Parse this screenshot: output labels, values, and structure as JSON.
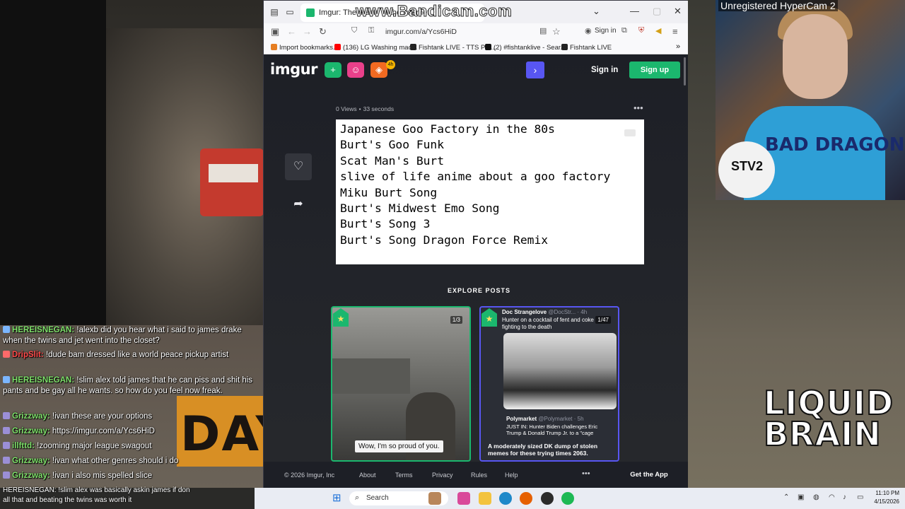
{
  "overlay": {
    "bandicam": "www.Bandicam.com",
    "hypercam": "Unregistered HyperCam 2",
    "liquid_brain": [
      "LIQUID",
      "BRAIN"
    ],
    "day_text": "DAY",
    "webcam_shirt": "BAD DRAGON",
    "webcam_badge": "STV2"
  },
  "chat": [
    {
      "user": "HEREISNEGAN:",
      "text": "!alexb did you hear what i said to james drake when the twins and jet went into the closet?",
      "color": "#7ee06a"
    },
    {
      "user": "DripSlit:",
      "text": "!dude bam dressed like a world peace pickup artist",
      "color": "#ff4a4a"
    },
    {
      "user": "HEREISNEGAN:",
      "text": "!slim alex told james that he can piss and shit his pants and be gay all he wants. so how do you feel now freak.",
      "color": "#7ee06a"
    },
    {
      "user": "Grizzway:",
      "text": "!ivan these are your options",
      "color": "#7ee06a"
    },
    {
      "user": "Grizzway:",
      "text": "https://imgur.com/a/Ycs6HiD",
      "color": "#7ee06a"
    },
    {
      "user": "illfttd:",
      "text": "!zooming major league swagout",
      "color": "#7ee06a"
    },
    {
      "user": "Grizzway:",
      "text": "!ivan what other genres should i do",
      "color": "#7ee06a"
    },
    {
      "user": "Grizzway:",
      "text": "!ivan i also mis spelled slice",
      "color": "#7ee06a"
    }
  ],
  "chat_footer": [
    "HEREISNEGAN: !slim alex was basically askin james if don",
    "all that and beating the twins was worth it"
  ],
  "browser": {
    "tab_title": "Imgur: The magic of the Internet",
    "url": "imgur.com/a/Ycs6HiD",
    "nav_signin": "Sign in",
    "bookmarks": [
      {
        "label": "Import bookmarks...",
        "color": "#e67e22"
      },
      {
        "label": "(136) LG Washing mac...",
        "color": "#ff0000"
      },
      {
        "label": "Fishtank LIVE - TTS Pla...",
        "color": "#222222"
      },
      {
        "label": "(2) #fishtanklive - Sear...",
        "color": "#111111"
      },
      {
        "label": "Fishtank LIVE",
        "color": "#222222"
      }
    ]
  },
  "imgur": {
    "logo": "imgur",
    "badge_count": "4h",
    "signin": "Sign in",
    "signup": "Sign up",
    "views": "0 Views",
    "time": "33 seconds",
    "post_lines": [
      "Japanese Goo Factory in the 80s",
      "Burt's Goo Funk",
      "Scat Man's Burt",
      "slive of life anime about a goo factory",
      "Miku Burt Song",
      "Burt's Midwest Emo Song",
      "Burt's Song 3",
      "Burt's Song Dragon Force Remix"
    ],
    "explore_label": "EXPLORE POSTS",
    "cards": [
      {
        "count": "1/3",
        "caption": "Wow, I'm so proud of you."
      },
      {
        "count": "1/47",
        "author": "Doc Strangelove",
        "handle": "@DocStr... · 4h",
        "text": "Hunter on a cocktail of fent and coke fighting to the death",
        "author2": "Polymarket",
        "handle2": "@Polymarket · 5h",
        "text2": "JUST IN: Hunter Biden challenges Eric Trump & Donald Trump Jr. to a \"cage",
        "caption": "A moderately sized DK dump of stolen memes for these trying times 2063."
      }
    ],
    "footer": {
      "copyright": "© 2026 Imgur, Inc",
      "about": "About",
      "terms": "Terms",
      "privacy": "Privacy",
      "rules": "Rules",
      "help": "Help",
      "more": "•••",
      "get_app": "Get the App"
    }
  },
  "taskbar": {
    "search": "Search",
    "time": "11:10 PM",
    "date": "4/15/2026"
  }
}
